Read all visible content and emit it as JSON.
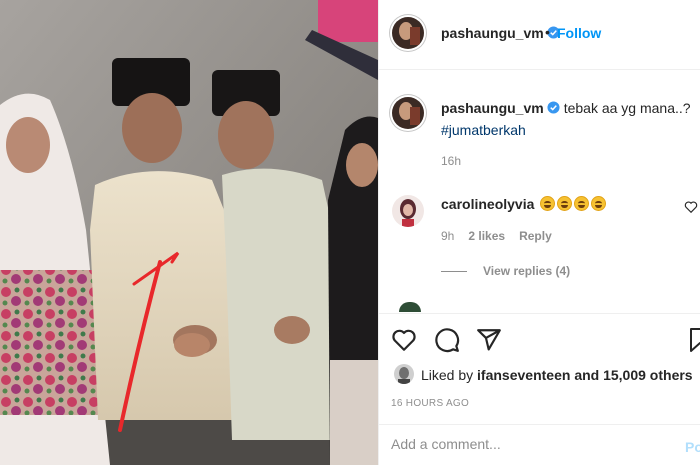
{
  "post": {
    "author": "pashaungu_vm",
    "follow_label": "Follow",
    "separator": "•",
    "verified_icon": "verified-badge-icon"
  },
  "caption": {
    "author": "pashaungu_vm",
    "text": "tebak aa yg mana..?",
    "hashtag": "#jumatberkah",
    "age": "16h"
  },
  "comment": {
    "author": "carolineolyvia",
    "emoji_count": 4,
    "age": "9h",
    "likes": "2 likes",
    "reply_label": "Reply",
    "view_replies": "View replies (4)"
  },
  "actions": {
    "icons": [
      "heart-icon",
      "comment-icon",
      "share-icon",
      "save-icon"
    ]
  },
  "likes": {
    "prefix": "Liked by",
    "liker": "ifanseventeen",
    "suffix": "and 15,009 others"
  },
  "timestamp": "16 HOURS AGO",
  "add_comment": {
    "placeholder": "Add a comment...",
    "post_label": "Po"
  },
  "colors": {
    "link_blue": "#0095f6",
    "hashtag_blue": "#00376b",
    "muted": "#8e8e8e",
    "annotation_red": "#e8282b"
  }
}
